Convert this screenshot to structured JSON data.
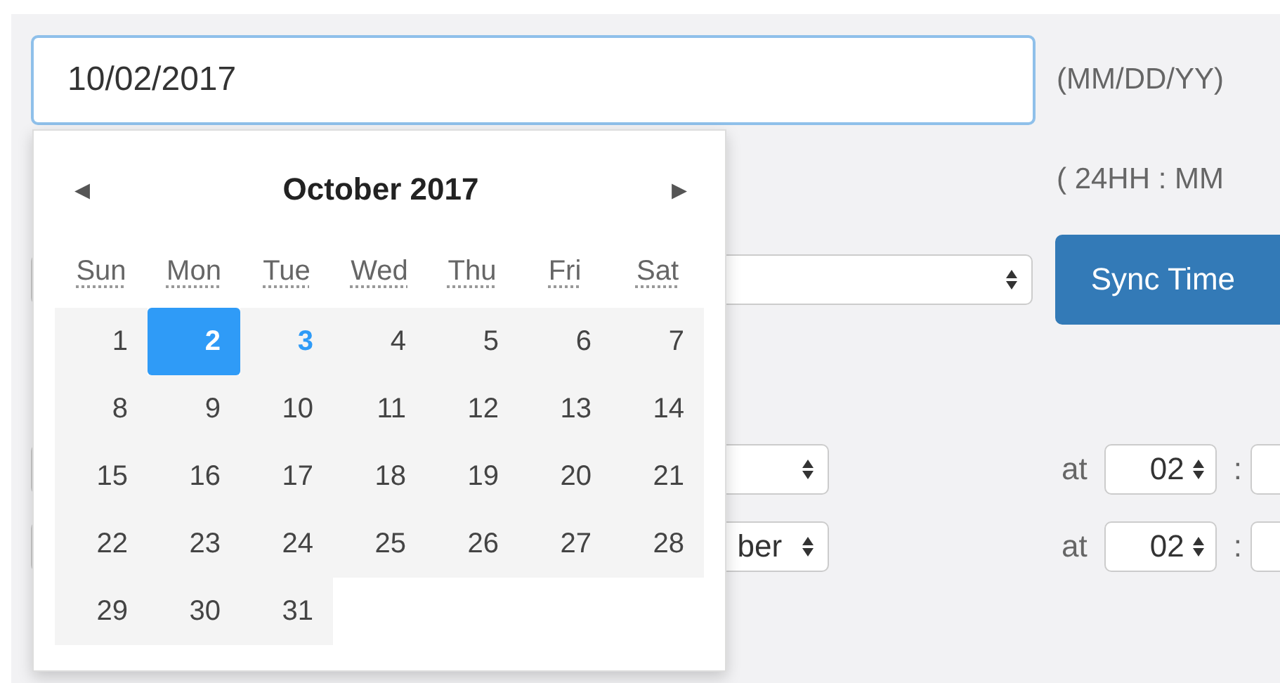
{
  "date_field": {
    "value": "10/02/2017",
    "hint": "(MM/DD/YY)"
  },
  "time_hint": "( 24HH : MM",
  "sync_row": {
    "button": "Sync Time"
  },
  "schedule_rows": [
    {
      "select_value": null,
      "at": "at",
      "hour": "02",
      "sep": ":"
    },
    {
      "select_value": "ber",
      "at": "at",
      "hour": "02",
      "sep": ":"
    }
  ],
  "calendar": {
    "title": "October 2017",
    "prev": "◂",
    "next": "▸",
    "weekdays": [
      "Sun",
      "Mon",
      "Tue",
      "Wed",
      "Thu",
      "Fri",
      "Sat"
    ],
    "weeks": [
      [
        {
          "day": "1",
          "selected": false,
          "today": false
        },
        {
          "day": "2",
          "selected": true,
          "today": false
        },
        {
          "day": "3",
          "selected": false,
          "today": true
        },
        {
          "day": "4",
          "selected": false,
          "today": false
        },
        {
          "day": "5",
          "selected": false,
          "today": false
        },
        {
          "day": "6",
          "selected": false,
          "today": false
        },
        {
          "day": "7",
          "selected": false,
          "today": false
        }
      ],
      [
        {
          "day": "8",
          "selected": false,
          "today": false
        },
        {
          "day": "9",
          "selected": false,
          "today": false
        },
        {
          "day": "10",
          "selected": false,
          "today": false
        },
        {
          "day": "11",
          "selected": false,
          "today": false
        },
        {
          "day": "12",
          "selected": false,
          "today": false
        },
        {
          "day": "13",
          "selected": false,
          "today": false
        },
        {
          "day": "14",
          "selected": false,
          "today": false
        }
      ],
      [
        {
          "day": "15",
          "selected": false,
          "today": false
        },
        {
          "day": "16",
          "selected": false,
          "today": false
        },
        {
          "day": "17",
          "selected": false,
          "today": false
        },
        {
          "day": "18",
          "selected": false,
          "today": false
        },
        {
          "day": "19",
          "selected": false,
          "today": false
        },
        {
          "day": "20",
          "selected": false,
          "today": false
        },
        {
          "day": "21",
          "selected": false,
          "today": false
        }
      ],
      [
        {
          "day": "22",
          "selected": false,
          "today": false
        },
        {
          "day": "23",
          "selected": false,
          "today": false
        },
        {
          "day": "24",
          "selected": false,
          "today": false
        },
        {
          "day": "25",
          "selected": false,
          "today": false
        },
        {
          "day": "26",
          "selected": false,
          "today": false
        },
        {
          "day": "27",
          "selected": false,
          "today": false
        },
        {
          "day": "28",
          "selected": false,
          "today": false
        }
      ],
      [
        {
          "day": "29",
          "selected": false,
          "today": false
        },
        {
          "day": "30",
          "selected": false,
          "today": false
        },
        {
          "day": "31",
          "selected": false,
          "today": false
        }
      ]
    ]
  }
}
